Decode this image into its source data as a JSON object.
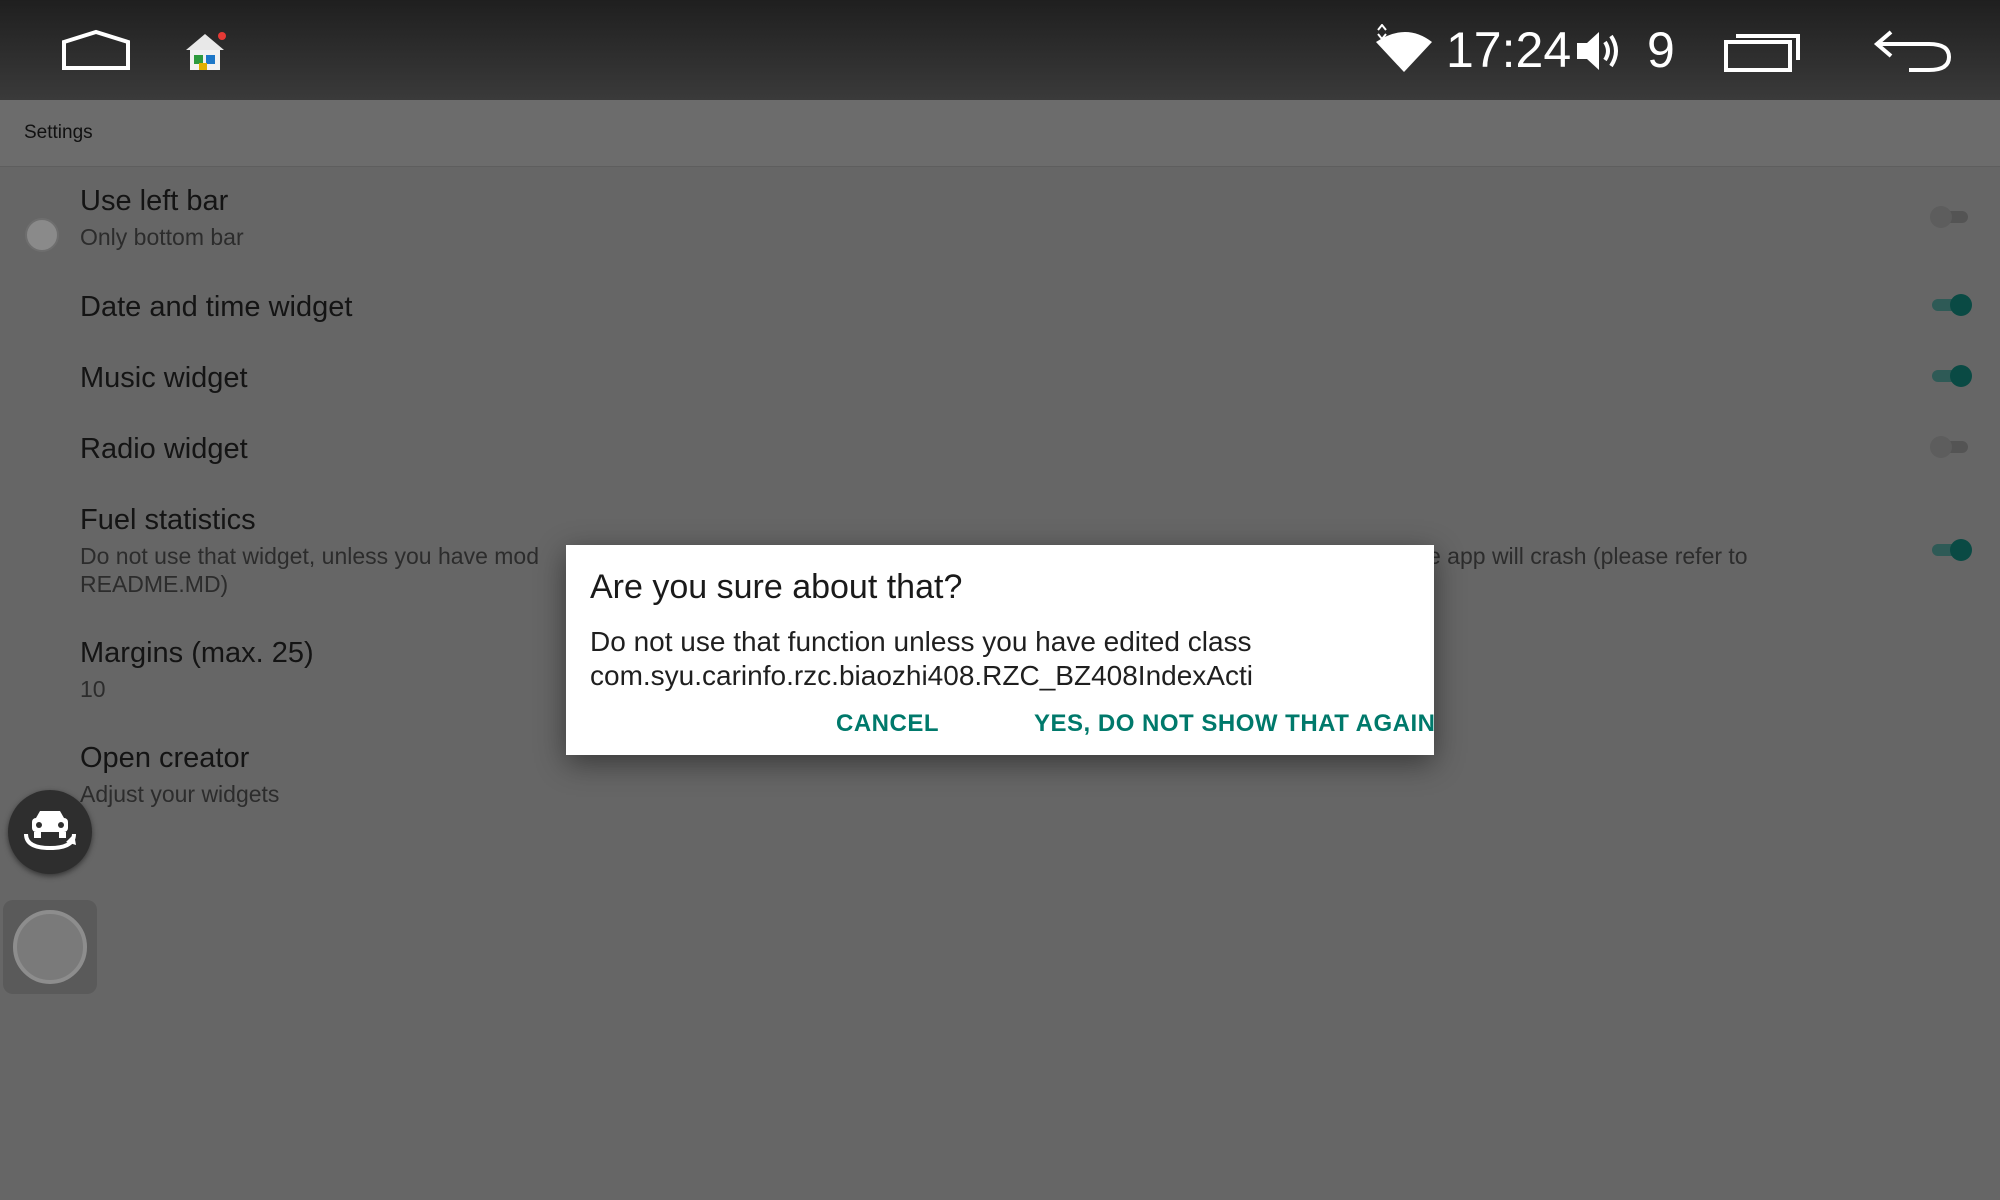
{
  "status_bar": {
    "time": "17:24",
    "volume_level": "9",
    "icons": [
      "home-icon",
      "launcher-icon",
      "wifi-icon",
      "volume-icon",
      "recents-icon",
      "back-icon"
    ]
  },
  "header": {
    "title": "Settings"
  },
  "preferences": [
    {
      "title": "Use left bar",
      "summary": "Only bottom bar",
      "switch": "off"
    },
    {
      "title": "Date and time widget",
      "summary": "",
      "switch": "on"
    },
    {
      "title": "Music widget",
      "summary": "",
      "switch": "on"
    },
    {
      "title": "Radio widget",
      "summary": "",
      "switch": "off"
    },
    {
      "title": "Fuel statistics",
      "summary_left": "Do not use that widget, unless you have mod",
      "summary_right": "e app will crash (please refer to",
      "summary_line2": "README.MD)",
      "switch": "on"
    },
    {
      "title": "Margins (max. 25)",
      "summary": "10"
    },
    {
      "title": "Open creator",
      "summary": "Adjust your widgets"
    }
  ],
  "dialog": {
    "title": "Are you sure about that?",
    "message": "Do not use that function unless you have edited class com.syu.carinfo.rzc.biaozhi408.RZC_BZ408IndexActi",
    "cancel_label": "CANCEL",
    "confirm_label": "YES, DO NOT SHOW THAT AGAIN"
  },
  "colors": {
    "accent": "#00796b",
    "scrim": "#666666",
    "status_bar": "#2b2b2b"
  }
}
